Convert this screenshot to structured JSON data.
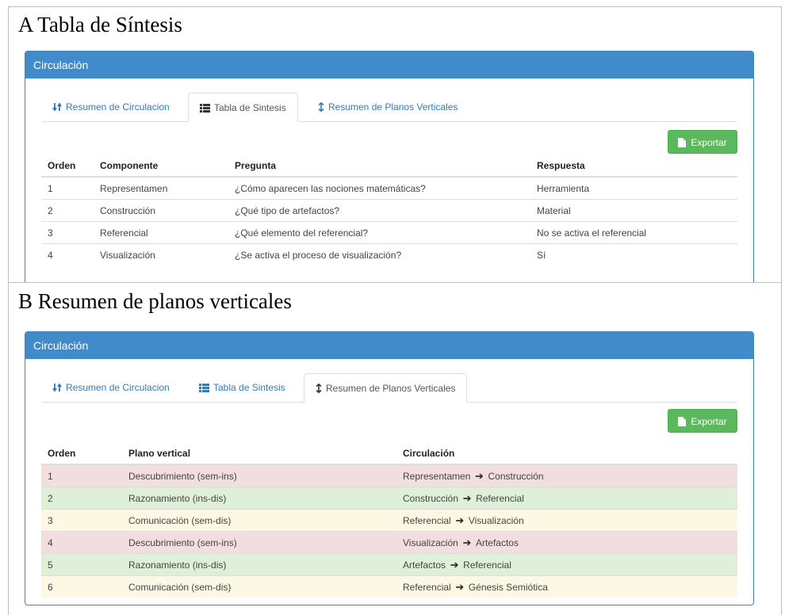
{
  "figure_a": {
    "label": "A Tabla de Síntesis",
    "panel_title": "Circulación",
    "tabs": [
      {
        "label": "Resumen de Circulacion",
        "icon": "sort-icon",
        "active": false
      },
      {
        "label": "Tabla de Sintesis",
        "icon": "list-icon",
        "active": true
      },
      {
        "label": "Resumen de Planos Verticales",
        "icon": "vertical-arrows-icon",
        "active": false
      }
    ],
    "export_label": "Exportar",
    "columns": [
      "Orden",
      "Componente",
      "Pregunta",
      "Respuesta"
    ],
    "rows": [
      [
        "1",
        "Representamen",
        "¿Cómo aparecen las nociones matemáticas?",
        "Herramienta"
      ],
      [
        "2",
        "Construcción",
        "¿Qué tipo de artefactos?",
        "Material"
      ],
      [
        "3",
        "Referencial",
        "¿Qué elemento del referencial?",
        "No se activa el referencial"
      ],
      [
        "4",
        "Visualización",
        "¿Se activa el proceso de visualización?",
        "Sí"
      ]
    ]
  },
  "figure_b": {
    "label": "B Resumen de planos verticales",
    "panel_title": "Circulación",
    "tabs": [
      {
        "label": "Resumen de Circulacion",
        "icon": "sort-icon",
        "active": false
      },
      {
        "label": "Tabla de Sintesis",
        "icon": "list-icon",
        "active": false
      },
      {
        "label": "Resumen de Planos Verticales",
        "icon": "vertical-arrows-icon",
        "active": true
      }
    ],
    "export_label": "Exportar",
    "columns": [
      "Orden",
      "Plano vertical",
      "Circulación"
    ],
    "rows": [
      {
        "orden": "1",
        "plano": "Descubrimiento (sem-ins)",
        "from": "Representamen",
        "to": "Construcción",
        "status": "danger"
      },
      {
        "orden": "2",
        "plano": "Razonamiento (ins-dis)",
        "from": "Construcción",
        "to": "Referencial",
        "status": "success"
      },
      {
        "orden": "3",
        "plano": "Comunicación (sem-dis)",
        "from": "Referencial",
        "to": "Visualización",
        "status": "warning"
      },
      {
        "orden": "4",
        "plano": "Descubrimiento (sem-ins)",
        "from": "Visualización",
        "to": "Artefactos",
        "status": "danger"
      },
      {
        "orden": "5",
        "plano": "Razonamiento (ins-dis)",
        "from": "Artefactos",
        "to": "Referencial",
        "status": "success"
      },
      {
        "orden": "6",
        "plano": "Comunicación (sem-dis)",
        "from": "Referencial",
        "to": "Génesis Semiótica",
        "status": "warning"
      }
    ],
    "row_colors": {
      "danger": "#f2dede",
      "success": "#dff0d8",
      "warning": "#fcf8e3"
    }
  },
  "colors": {
    "panel_heading": "#428bca",
    "export_button": "#5cb85c",
    "link": "#337ab7"
  }
}
